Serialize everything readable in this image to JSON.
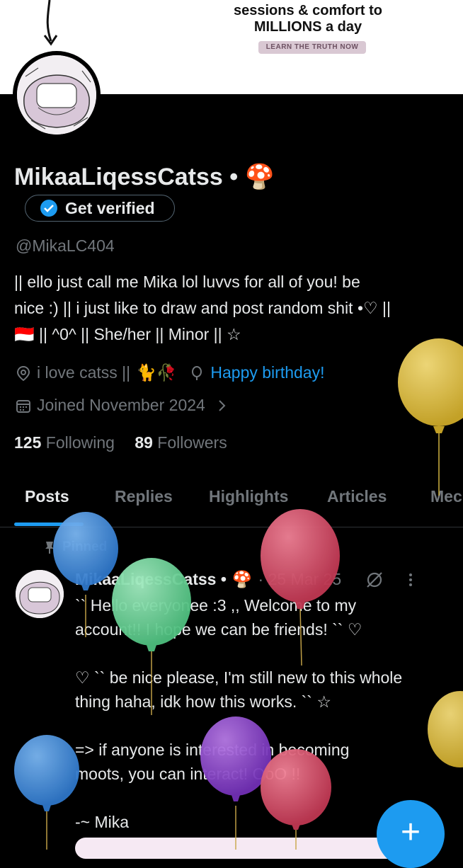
{
  "banner": {
    "text_line1": "sessions & comfort to",
    "text_line2": "MILLIONS a day",
    "button_label": "LEARN THE TRUTH NOW"
  },
  "profile": {
    "display_name": "MikaaLiqessCatss",
    "name_suffix": "•",
    "name_emoji": "🍄",
    "verify_label": "Get verified",
    "handle": "@MikaLC404",
    "bio_line1": "|| ello just call me Mika lol luvvs for all of you! be",
    "bio_line2": "nice :) || i just like to draw and post random shit •♡ ||",
    "bio_line3_flag": "🇮🇩",
    "bio_line3": "|| ^0^ || She/her || Minor || ☆",
    "location": "i love catss ||",
    "location_emoji": "🐈🥀",
    "birthday": "Happy birthday!",
    "joined": "Joined November 2024",
    "following_count": "125",
    "following_label": "Following",
    "followers_count": "89",
    "followers_label": "Followers"
  },
  "tabs": [
    {
      "label": "Posts",
      "active": true
    },
    {
      "label": "Replies",
      "active": false
    },
    {
      "label": "Highlights",
      "active": false
    },
    {
      "label": "Articles",
      "active": false
    },
    {
      "label": "Mec",
      "active": false
    }
  ],
  "post": {
    "pinned_label": "Pinned",
    "author": "MikaaLiqessCatss •",
    "author_emoji": "🍄",
    "date": "· 25 Mar 25",
    "body": "`` Hello everyonee :3 ,, Welcome to my\naccount!! I hope we can be friends! `` ♡\n\n♡ `` be nice please, I'm still new to this whole\nthing haha, idk how this works. `` ☆\n\n=> if anyone is interested in becoming\nmoots, you can interact! OoO !!\n\n-~ Mika"
  },
  "fab_label": "+",
  "colors": {
    "accent": "#1d9bf0",
    "muted": "#71767b",
    "text": "#e7e9ea",
    "balloon_yellow": "#e0bd3c",
    "balloon_blue": "#3f8ce0",
    "balloon_green": "#6ed39a",
    "balloon_red": "#d84a66",
    "balloon_purple": "#8b3fd0"
  }
}
